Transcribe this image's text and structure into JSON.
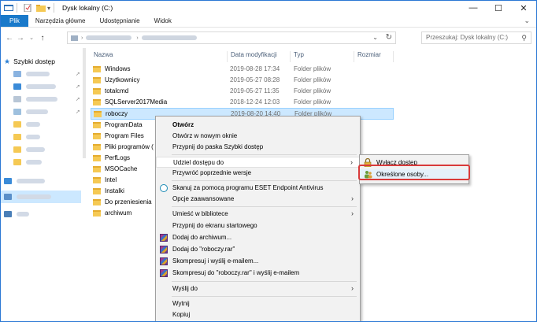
{
  "window": {
    "title": "Dysk lokalny (C:)",
    "accent": "#1979ca"
  },
  "ribbon": {
    "tabs": [
      "Plik",
      "Narzędzia główne",
      "Udostępnianie",
      "Widok"
    ]
  },
  "search": {
    "placeholder": "Przeszukaj: Dysk lokalny (C:)"
  },
  "navpane": {
    "quick_access": "Szybki dostęp"
  },
  "columns": {
    "name": "Nazwa",
    "date": "Data modyfikacji",
    "type": "Typ",
    "size": "Rozmiar"
  },
  "files": [
    {
      "name": "Windows",
      "date": "2019-08-28 17:34",
      "type": "Folder plików"
    },
    {
      "name": "Uzytkownicy",
      "date": "2019-05-27 08:28",
      "type": "Folder plików"
    },
    {
      "name": "totalcmd",
      "date": "2019-05-27 11:35",
      "type": "Folder plików"
    },
    {
      "name": "SQLServer2017Media",
      "date": "2018-12-24 12:03",
      "type": "Folder plików"
    },
    {
      "name": "roboczy",
      "date": "2019-08-20 14:40",
      "type": "Folder plików"
    },
    {
      "name": "ProgramData",
      "date": "",
      "type": ""
    },
    {
      "name": "Program Files",
      "date": "",
      "type": ""
    },
    {
      "name": "Pliki programów (",
      "date": "",
      "type": ""
    },
    {
      "name": "PerfLogs",
      "date": "",
      "type": ""
    },
    {
      "name": "MSOCache",
      "date": "",
      "type": ""
    },
    {
      "name": "Intel",
      "date": "",
      "type": ""
    },
    {
      "name": "Instalki",
      "date": "",
      "type": ""
    },
    {
      "name": "Do przeniesienia",
      "date": "",
      "type": ""
    },
    {
      "name": "archiwum",
      "date": "",
      "type": ""
    }
  ],
  "context_menu": {
    "open": "Otwórz",
    "open_new_window": "Otwórz w nowym oknie",
    "pin_quick_access": "Przypnij do paska Szybki dostęp",
    "share_with": "Udziel dostępu do",
    "restore_versions": "Przywróć poprzednie wersje",
    "eset_scan": "Skanuj za pomocą programu ESET Endpoint Antivirus",
    "advanced_options": "Opcje zaawansowane",
    "include_library": "Umieść w bibliotece",
    "pin_start": "Przypnij do ekranu startowego",
    "add_archive": "Dodaj do archiwum...",
    "add_rar": "Dodaj do \"roboczy.rar\"",
    "compress_email": "Skompresuj i wyślij e-mailem...",
    "compress_rar_email": "Skompresuj do \"roboczy.rar\" i wyślij e-mailem",
    "send_to": "Wyślij do",
    "cut": "Wytnij",
    "copy": "Kopiuj"
  },
  "submenu": {
    "remove_access": "Wyłącz dostęp",
    "specific_people": "Określone osoby..."
  },
  "highlight_color": "#d93a3a"
}
